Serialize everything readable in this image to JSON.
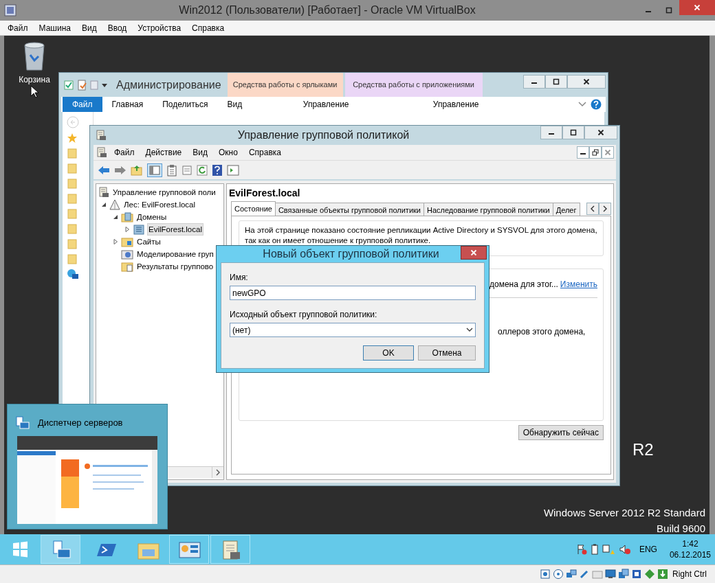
{
  "virtualbox": {
    "title": "Win2012 (Пользователи) [Работает] - Oracle VM VirtualBox",
    "menu": [
      "Файл",
      "Машина",
      "Вид",
      "Ввод",
      "Устройства",
      "Справка"
    ],
    "host_key": "Right Ctrl"
  },
  "desktop": {
    "icons": [
      {
        "label": "Корзина"
      }
    ],
    "branding": {
      "edition": "R2",
      "product": "Windows Server 2012 R2 Standard",
      "build": "Build 9600"
    }
  },
  "explorer": {
    "title": "Администрирование",
    "tabs": [
      {
        "label": "Файл",
        "selected": true
      },
      {
        "label": "Главная",
        "selected": false
      },
      {
        "label": "Поделиться",
        "selected": false
      },
      {
        "label": "Вид",
        "selected": false
      }
    ],
    "tool_groups": [
      {
        "label": "Средства работы с ярлыками",
        "color": "#fbd8c6",
        "tab": {
          "label": "Управление",
          "selected": false
        }
      },
      {
        "label": "Средства работы с приложениями",
        "color": "#ead6f6",
        "tab": {
          "label": "Управление",
          "selected": false
        }
      }
    ]
  },
  "gpmc": {
    "title": "Управление групповой политикой",
    "menu": [
      "Файл",
      "Действие",
      "Вид",
      "Окно",
      "Справка"
    ],
    "tree": [
      {
        "label": "Управление групповой поли",
        "kind": "console",
        "selected": false,
        "children": [
          {
            "label": "Лес: EvilForest.local",
            "kind": "forest",
            "expanded": true,
            "selected": false,
            "children": [
              {
                "label": "Домены",
                "kind": "domains",
                "expanded": true,
                "selected": false,
                "children": [
                  {
                    "label": "EvilForest.local",
                    "kind": "domain",
                    "expanded": false,
                    "selected": true
                  }
                ]
              },
              {
                "label": "Сайты",
                "kind": "sites",
                "expanded": false,
                "selected": false
              },
              {
                "label": "Моделирование груп",
                "kind": "modeling",
                "selected": false
              },
              {
                "label": "Результаты группово",
                "kind": "results",
                "selected": false
              }
            ]
          }
        ]
      }
    ],
    "details": {
      "heading": "EvilForest.local",
      "tabs": [
        {
          "label": "Состояние",
          "selected": true
        },
        {
          "label": "Связанные объекты групповой политики",
          "selected": false
        },
        {
          "label": "Наследование групповой политики",
          "selected": false
        },
        {
          "label": "Делег",
          "selected": false
        }
      ],
      "description": "На этой странице показано состояние репликации Active Directory и SYSVOL для этого домена, так как он имеет отношение к групповой политике.",
      "line_1": "домена для этог...",
      "link": "Изменить",
      "line_2": "оллеров этого домена,",
      "button": "Обнаружить сейчас"
    }
  },
  "dialog": {
    "title": "Новый объект групповой политики",
    "name_label": "Имя:",
    "name_value": "newGPO",
    "source_label": "Исходный объект групповой политики:",
    "source_value": "(нет)",
    "buttons": [
      "OK",
      "Отмена"
    ]
  },
  "preview": {
    "title": "Диспетчер серверов"
  },
  "taskbar": {
    "apps": [
      {
        "kind": "server-manager",
        "running": true,
        "previewed": true
      },
      {
        "kind": "powershell",
        "running": false,
        "previewed": false
      },
      {
        "kind": "explorer",
        "running": false,
        "previewed": false
      },
      {
        "kind": "control-panel",
        "running": true,
        "previewed": false
      },
      {
        "kind": "gpmc",
        "running": true,
        "previewed": false
      }
    ],
    "language": "ENG",
    "time": "1:42",
    "date": "06.12.2015"
  }
}
